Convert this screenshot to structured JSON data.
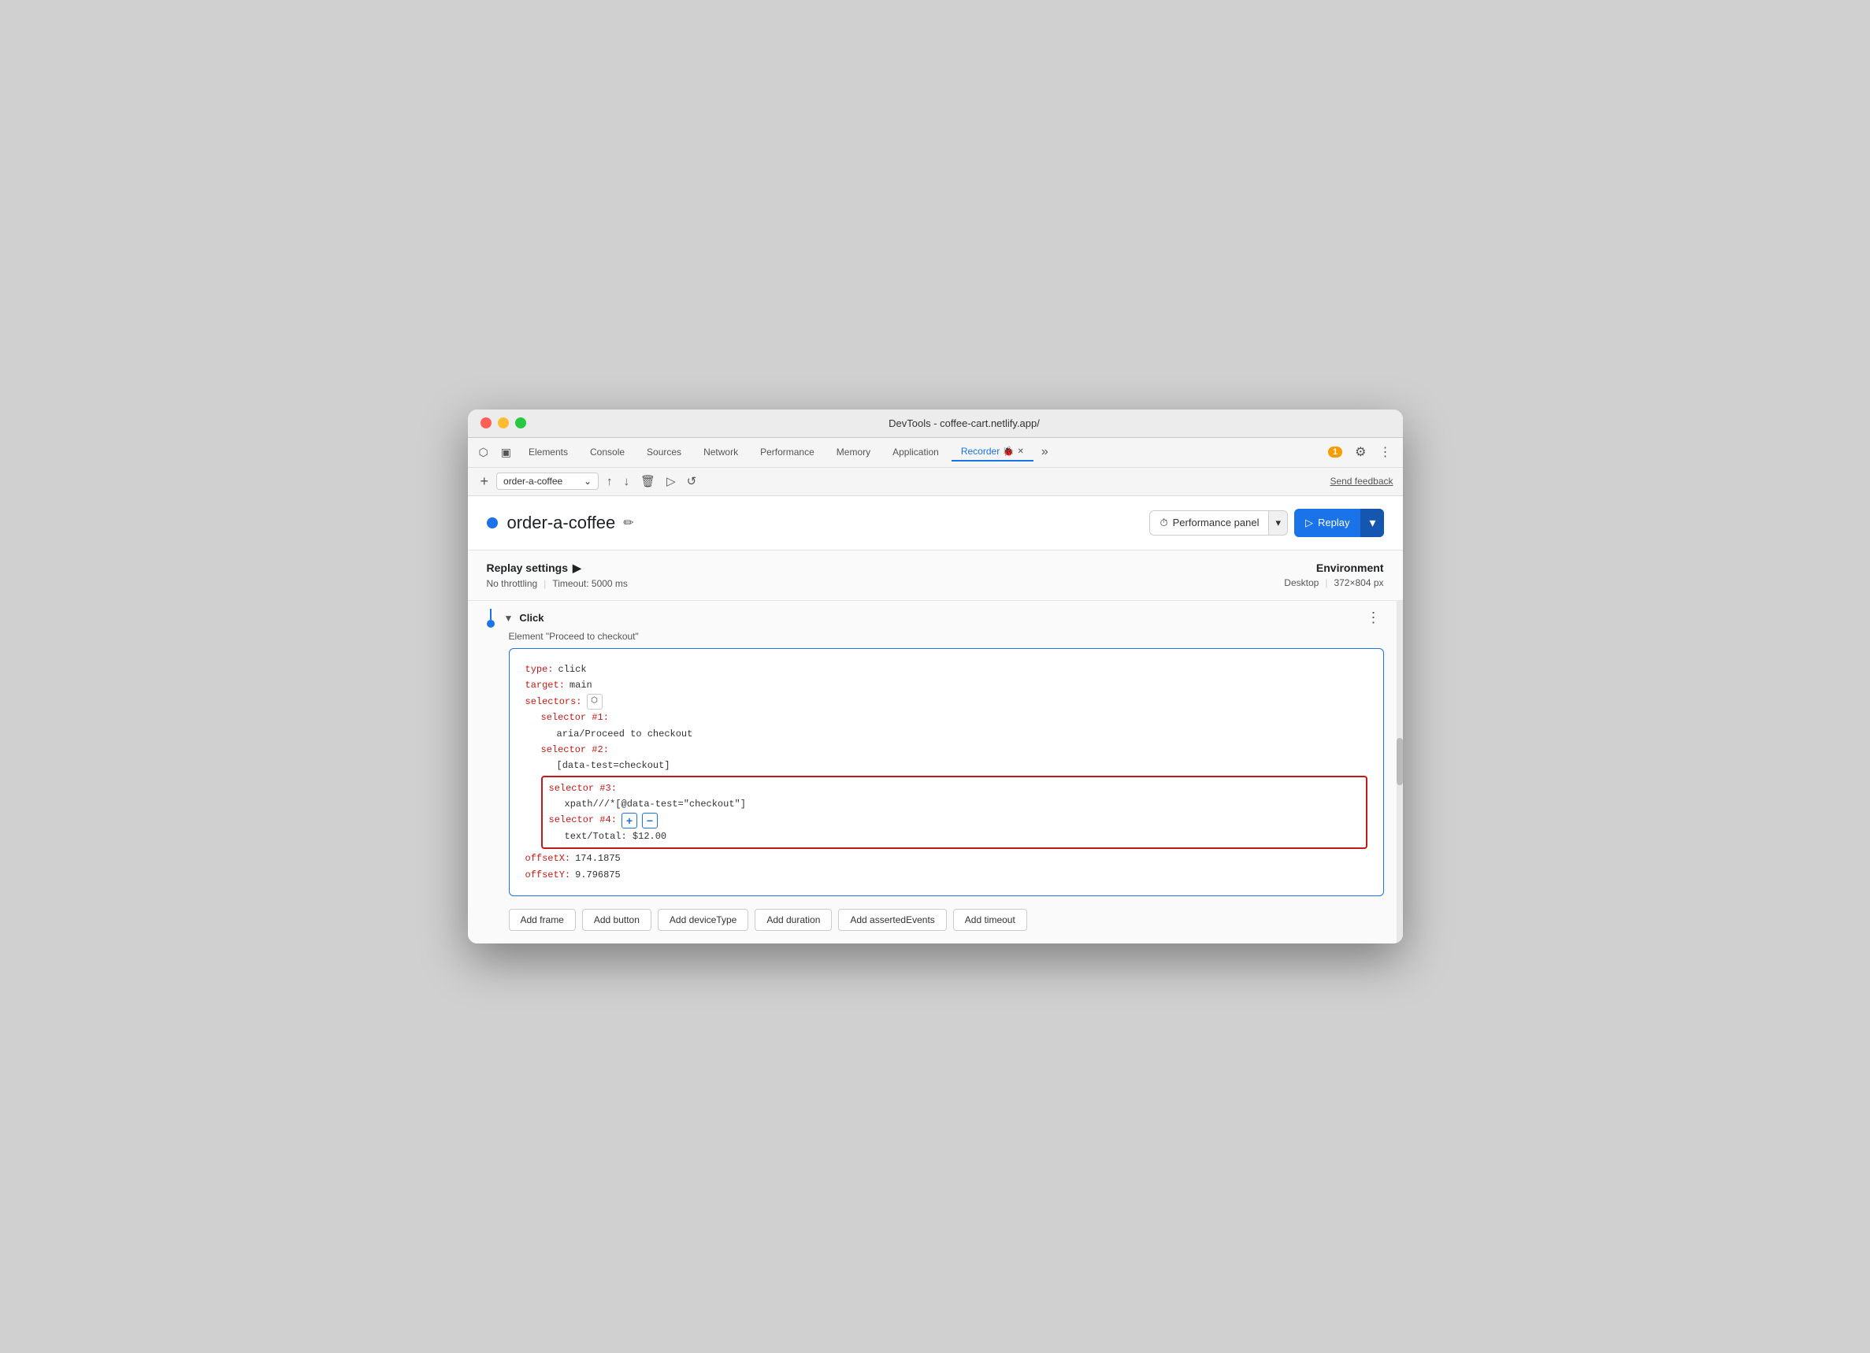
{
  "window": {
    "title": "DevTools - coffee-cart.netlify.app/"
  },
  "tabs": {
    "items": [
      {
        "label": "Elements",
        "active": false
      },
      {
        "label": "Console",
        "active": false
      },
      {
        "label": "Sources",
        "active": false
      },
      {
        "label": "Network",
        "active": false
      },
      {
        "label": "Performance",
        "active": false
      },
      {
        "label": "Memory",
        "active": false
      },
      {
        "label": "Application",
        "active": false
      },
      {
        "label": "Recorder 🐞",
        "active": true
      }
    ],
    "more": "»",
    "badge": "1",
    "send_feedback": "Send feedback"
  },
  "toolbar": {
    "recording_name": "order-a-coffee",
    "new_label": "+",
    "send_feedback": "Send feedback"
  },
  "recording": {
    "title": "order-a-coffee",
    "dot_color": "#1a73e8",
    "performance_panel_label": "Performance panel",
    "replay_label": "Replay"
  },
  "replay_settings": {
    "title": "Replay settings",
    "arrow": "▶",
    "throttling": "No throttling",
    "timeout": "Timeout: 5000 ms",
    "environment_label": "Environment",
    "environment_value": "Desktop",
    "resolution": "372×804 px"
  },
  "step": {
    "type_label": "Click",
    "element_label": "Element \"Proceed to checkout\"",
    "code": {
      "type_key": "type:",
      "type_value": "click",
      "target_key": "target:",
      "target_value": "main",
      "selectors_key": "selectors:",
      "selector1_key": "selector #1:",
      "selector1_value": "aria/Proceed to checkout",
      "selector2_key": "selector #2:",
      "selector2_value": "[data-test=checkout]",
      "selector3_key": "selector #3:",
      "selector3_value": "xpath///*[@data-test=\"checkout\"]",
      "selector4_key": "selector #4:",
      "selector4_value": "text/Total: $12.00",
      "offsetX_key": "offsetX:",
      "offsetX_value": "174.1875",
      "offsetY_key": "offsetY:",
      "offsetY_value": "9.796875"
    }
  },
  "action_buttons": [
    "Add frame",
    "Add button",
    "Add deviceType",
    "Add duration",
    "Add assertedEvents",
    "Add timeout"
  ],
  "colors": {
    "accent": "#1a73e8",
    "code_key": "#c41a16",
    "highlight_border": "#c41a16"
  }
}
